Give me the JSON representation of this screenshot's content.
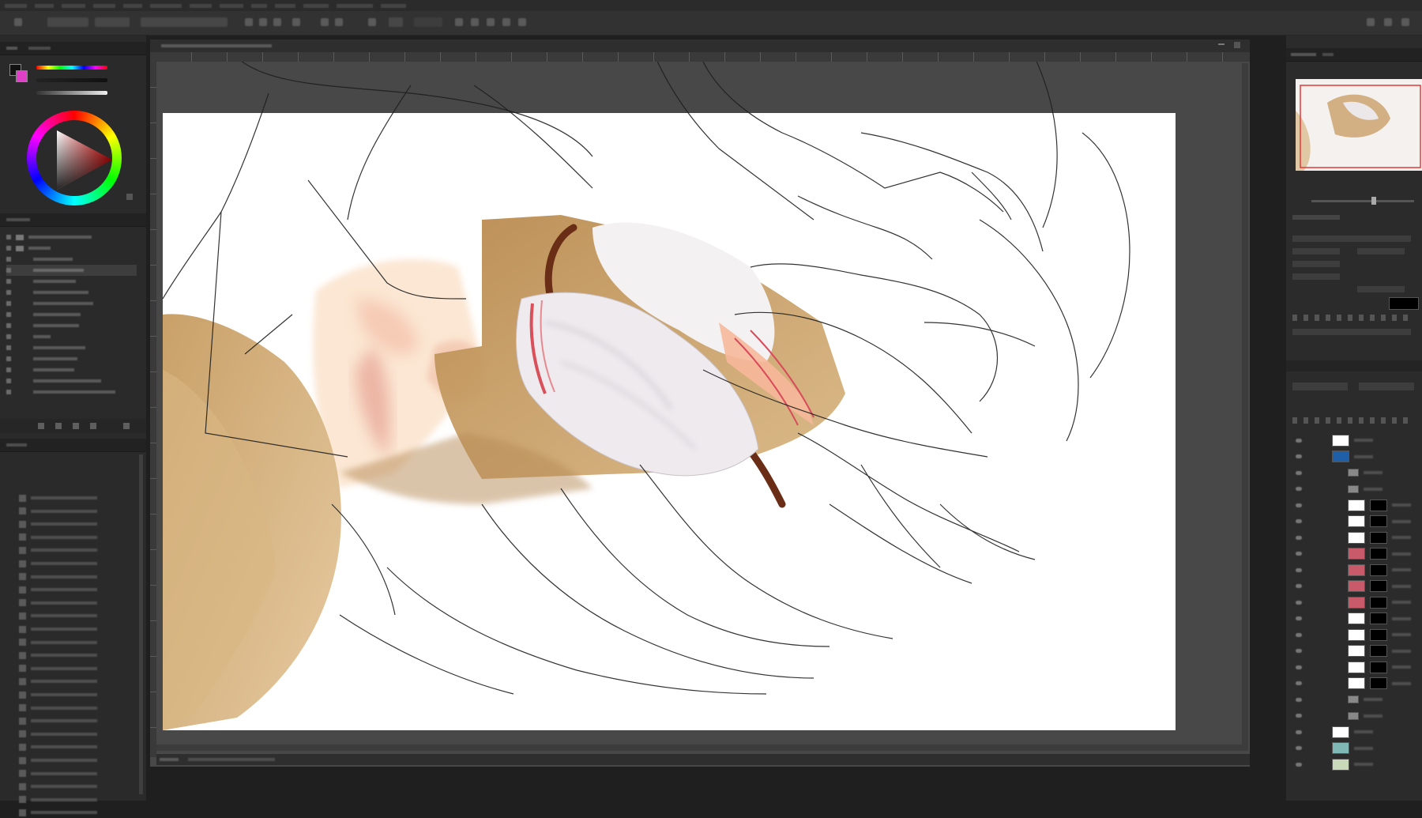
{
  "colors": {
    "accent_blue": "#1f5fa8",
    "selection_red": "#e23a3a",
    "bg_dark": "#1f1f1f",
    "panel": "#2a2a2a",
    "canvas": "#ffffff",
    "skin": "#f6c7a9",
    "uniform_tan": "#c9a068",
    "uniform_brown": "#6a2d16"
  },
  "icons": [
    "move-tool-icon",
    "eyedropper-icon",
    "color-wheel-icon",
    "folder-icon",
    "eye-icon",
    "layer-thumbnail-icon",
    "layer-mask-icon",
    "new-layer-icon",
    "trash-icon",
    "minimize-icon",
    "close-icon"
  ]
}
